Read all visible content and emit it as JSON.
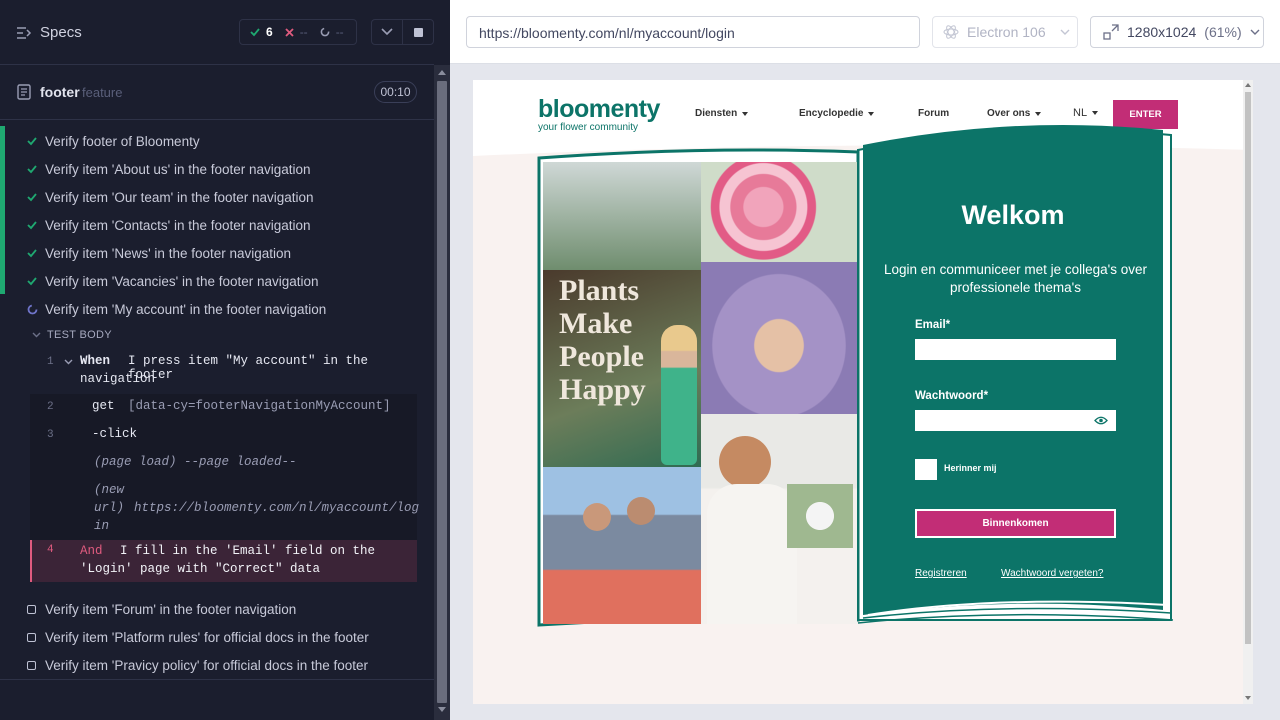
{
  "reporter": {
    "specs_label": "Specs",
    "stats": {
      "passed": "6",
      "failed": "--",
      "pending": "--"
    },
    "spec": {
      "name": "footer",
      "type": "feature",
      "duration": "00:10"
    },
    "tests": [
      {
        "title": "Verify footer of Bloomenty",
        "state": "passed"
      },
      {
        "title": "Verify item 'About us' in the footer navigation",
        "state": "passed"
      },
      {
        "title": "Verify item 'Our team' in the footer navigation",
        "state": "passed"
      },
      {
        "title": "Verify item 'Contacts' in the footer navigation",
        "state": "passed"
      },
      {
        "title": "Verify item 'News' in the footer navigation",
        "state": "passed"
      },
      {
        "title": "Verify item 'Vacancies' in the footer navigation",
        "state": "passed"
      },
      {
        "title": "Verify item 'My account' in the footer navigation",
        "state": "running"
      },
      {
        "title": "Verify item 'Forum' in the footer navigation",
        "state": "pending"
      },
      {
        "title": "Verify item 'Platform rules' for official docs in the footer",
        "state": "pending"
      },
      {
        "title": "Verify item 'Pravicy policy' for official docs in the footer",
        "state": "pending"
      }
    ],
    "test_body_label": "TEST BODY",
    "commands": {
      "step1": {
        "num": "1",
        "keyword": "When",
        "text_line1": "I press item \"My account\" in the footer",
        "text_line2": "navigation"
      },
      "cmd2": {
        "num": "2",
        "name": "get",
        "message": "[data-cy=footerNavigationMyAccount]"
      },
      "cmd3": {
        "num": "3",
        "name": "-click"
      },
      "page_load": {
        "name": "(page load)",
        "message": "--page loaded--"
      },
      "new_url": {
        "name_line1": "(new",
        "name_line2": "url)",
        "message_line1": "https://bloomenty.com/nl/myaccount/log",
        "message_line2": "in"
      },
      "step4": {
        "num": "4",
        "keyword": "And",
        "text_line1": "I fill in the 'Email' field on the",
        "text_line2": "'Login' page with \"Correct\" data"
      }
    }
  },
  "aut": {
    "url": "https://bloomenty.com/nl/myaccount/login",
    "browser": "Electron 106",
    "viewport": "1280x1024",
    "scale": "(61%)"
  },
  "site": {
    "logo": "bloomenty",
    "tagline": "your flower community",
    "nav": [
      "Diensten",
      "Encyclopedie",
      "Forum",
      "Over ons"
    ],
    "lang": "NL",
    "enter": "ENTER",
    "collage_text": [
      "Plants",
      "Make",
      "People",
      "Happy"
    ],
    "welcome": "Welkom",
    "subtitle": "Login en communiceer met je collega's over professionele thema's",
    "email_label": "Email*",
    "password_label": "Wachtwoord*",
    "remember": "Herinner mij",
    "login_button": "Binnenkomen",
    "register": "Registreren",
    "forgot": "Wachtwoord vergeten?",
    "colors": {
      "teal": "#0c7468",
      "pink": "#c22d76"
    }
  }
}
